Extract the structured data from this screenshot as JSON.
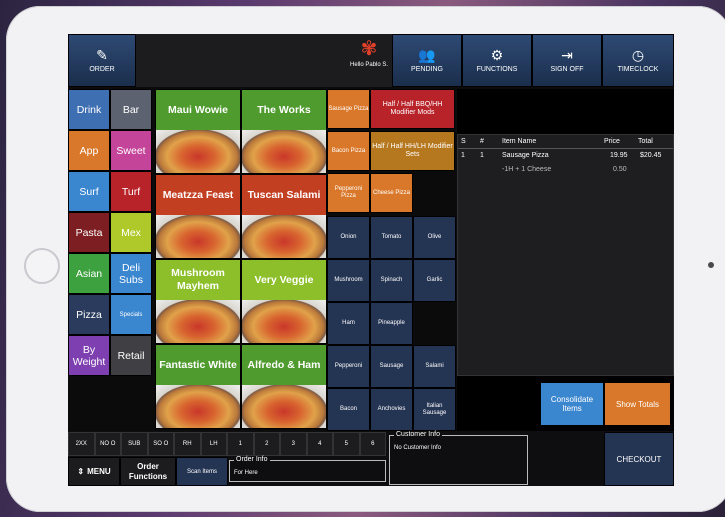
{
  "topbar": {
    "order": "ORDER",
    "user": "Hello Pablo S.",
    "pending": "PENDING",
    "functions": "FUNCTIONS",
    "sign_off": "SIGN OFF",
    "timeclock": "TIMECLOCK"
  },
  "categories": [
    {
      "label": "Drink",
      "color": "#3f6fb3"
    },
    {
      "label": "Bar",
      "color": "#5c6270"
    },
    {
      "label": "App",
      "color": "#d9782a"
    },
    {
      "label": "Sweet",
      "color": "#c4449a"
    },
    {
      "label": "Surf",
      "color": "#3a86cf"
    },
    {
      "label": "Turf",
      "color": "#b8232a"
    },
    {
      "label": "Pasta",
      "color": "#7d1f22"
    },
    {
      "label": "Mex",
      "color": "#b0c92a"
    },
    {
      "label": "Asian",
      "color": "#3ea13f"
    },
    {
      "label": "Deli Subs",
      "color": "#3a86cf"
    },
    {
      "label": "Pizza",
      "color": "#2a3b5e"
    },
    {
      "label": "Specials",
      "color": "#3a86cf"
    },
    {
      "label": "By Weight",
      "color": "#7e3fb0"
    },
    {
      "label": "Retail",
      "color": "#3f3f44"
    }
  ],
  "pizzas": [
    {
      "label": "Maui Wowie",
      "color": "#4f9b2d"
    },
    {
      "label": "The Works",
      "color": "#4f9b2d"
    },
    {
      "label": "Meatzza Feast",
      "color": "#c33f22"
    },
    {
      "label": "Tuscan Salami",
      "color": "#c33f22"
    },
    {
      "label": "Mushroom Mayhem",
      "color": "#8cbf2a"
    },
    {
      "label": "Very Veggie",
      "color": "#8cbf2a"
    },
    {
      "label": "Fantastic White",
      "color": "#4f9b2d"
    },
    {
      "label": "Alfredo & Ham",
      "color": "#4f9b2d"
    }
  ],
  "modifiers": {
    "sausage_pizza": "Sausage Pizza",
    "half_half_bbq": "Half / Half BBQ/HH Modifier Mods",
    "bacon_pizza": "Bacon Pizza",
    "half_half_sets": "Half / Half HH/LH Modifier Sets",
    "pepperoni_pizza": "Pepperoni Pizza",
    "cheese_pizza": "Cheese Pizza"
  },
  "toppings": [
    [
      "Onion",
      "Tomato",
      "Olive"
    ],
    [
      "Mushroom",
      "Spinach",
      "Garlic"
    ],
    [
      "Ham",
      "Pineapple",
      ""
    ],
    [
      "Pepperoni",
      "Sausage",
      "Salami"
    ],
    [
      "Bacon",
      "Anchovies",
      "Italian Sausage"
    ]
  ],
  "order_table": {
    "headers": [
      "S",
      "#",
      "Item Name",
      "Price",
      "Total"
    ],
    "rows": [
      {
        "s": "1",
        "n": "1",
        "name": "Sausage Pizza",
        "price": "19.95",
        "total": "$20.45"
      },
      {
        "s": "",
        "n": "",
        "name": "-1H + 1 Cheese",
        "price": "0.50",
        "total": ""
      }
    ]
  },
  "right_buttons": {
    "consolidate": "Consolidate Items",
    "show_totals": "Show Totals",
    "checkout": "CHECKOUT"
  },
  "bottom": {
    "keys_row1": [
      "2XX",
      "NO O",
      "SUB",
      "SO O",
      "RH",
      "LH",
      "1",
      "2",
      "3",
      "4",
      "5",
      "6"
    ],
    "menu": "MENU",
    "order_functions": "Order Functions",
    "scan_items": "Scan Items",
    "order_info_label": "Order Info",
    "order_info_value": "For Here",
    "customer_info_label": "Customer Info",
    "customer_info_value": "No Customer Info"
  }
}
